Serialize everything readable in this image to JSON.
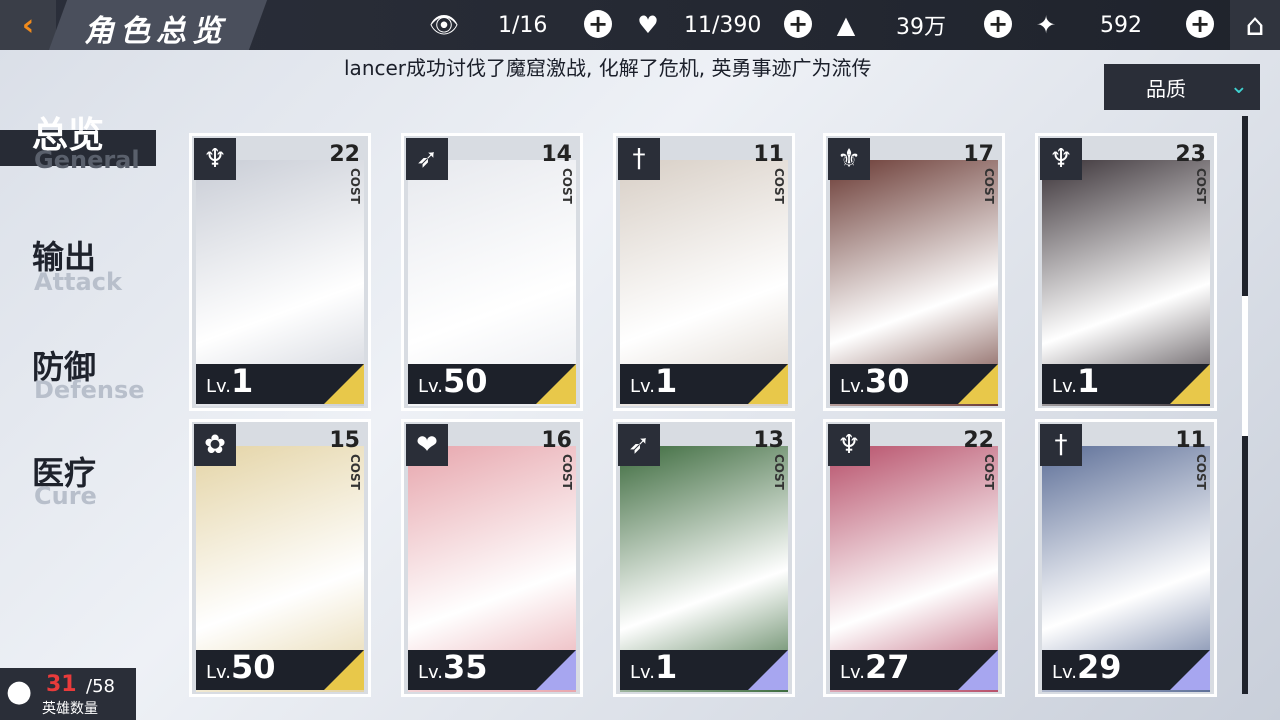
{
  "header": {
    "title": "角色总览",
    "resources": [
      {
        "icon": "eye-icon",
        "value": "1/16"
      },
      {
        "icon": "heart-token-icon",
        "value": "11/390"
      },
      {
        "icon": "gold-triangle-icon",
        "value": "39万"
      },
      {
        "icon": "star-crystal-icon",
        "value": "592"
      }
    ]
  },
  "news": "lancer成功讨伐了魔窟激战, 化解了危机, 英勇事迹广为流传",
  "sort": {
    "label": "品质"
  },
  "nav": [
    {
      "cn": "总览",
      "en": "General",
      "active": true
    },
    {
      "cn": "输出",
      "en": "Attack",
      "active": false
    },
    {
      "cn": "防御",
      "en": "Defense",
      "active": false
    },
    {
      "cn": "医疗",
      "en": "Cure",
      "active": false
    }
  ],
  "cards": [
    {
      "class_icon": "demon-icon",
      "cost": "22",
      "cost_label": "COST",
      "lv_prefix": "Lv.",
      "level": "1",
      "corner": "#e8c84a",
      "art": "#c9cdd6"
    },
    {
      "class_icon": "bow-icon",
      "cost": "14",
      "cost_label": "COST",
      "lv_prefix": "Lv.",
      "level": "50",
      "corner": "#e8c84a",
      "art": "#e7e9ee"
    },
    {
      "class_icon": "sword-icon",
      "cost": "11",
      "cost_label": "COST",
      "lv_prefix": "Lv.",
      "level": "1",
      "corner": "#e8c84a",
      "art": "#d8cfc6"
    },
    {
      "class_icon": "trident-icon",
      "cost": "17",
      "cost_label": "COST",
      "lv_prefix": "Lv.",
      "level": "30",
      "corner": "#e8c84a",
      "art": "#6a3a34"
    },
    {
      "class_icon": "demon-icon",
      "cost": "23",
      "cost_label": "COST",
      "lv_prefix": "Lv.",
      "level": "1",
      "corner": "#e8c84a",
      "art": "#3b3338"
    },
    {
      "class_icon": "lotus-icon",
      "cost": "15",
      "cost_label": "COST",
      "lv_prefix": "Lv.",
      "level": "50",
      "corner": "#e8c84a",
      "art": "#e4d4a6"
    },
    {
      "class_icon": "heart-icon",
      "cost": "16",
      "cost_label": "COST",
      "lv_prefix": "Lv.",
      "level": "35",
      "corner": "#a7a6f0",
      "art": "#e7a6ad"
    },
    {
      "class_icon": "bow-icon",
      "cost": "13",
      "cost_label": "COST",
      "lv_prefix": "Lv.",
      "level": "1",
      "corner": "#a7a6f0",
      "art": "#3d6b3e"
    },
    {
      "class_icon": "demon-icon",
      "cost": "22",
      "cost_label": "COST",
      "lv_prefix": "Lv.",
      "level": "27",
      "corner": "#a7a6f0",
      "art": "#b7506a"
    },
    {
      "class_icon": "sword-icon",
      "cost": "11",
      "cost_label": "COST",
      "lv_prefix": "Lv.",
      "level": "29",
      "corner": "#a7a6f0",
      "art": "#5d6f98"
    }
  ],
  "hero_count": {
    "current": "31",
    "total": "/58",
    "label": "英雄数量"
  }
}
